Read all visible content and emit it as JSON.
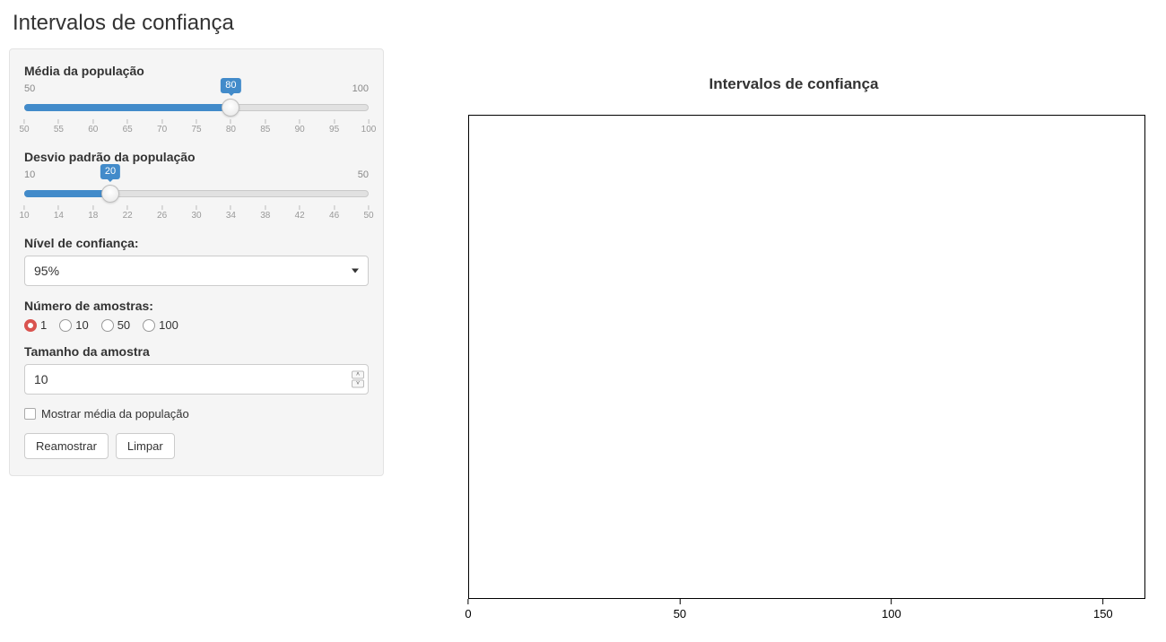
{
  "page_title": "Intervalos de confiança",
  "sidebar": {
    "mean": {
      "label": "Média da população",
      "min": 50,
      "max": 100,
      "value": 80,
      "min_text": "50",
      "max_text": "100",
      "value_text": "80",
      "ticks": [
        "50",
        "55",
        "60",
        "65",
        "70",
        "75",
        "80",
        "85",
        "90",
        "95",
        "100"
      ]
    },
    "sd": {
      "label": "Desvio padrão da população",
      "min": 10,
      "max": 50,
      "value": 20,
      "min_text": "10",
      "max_text": "50",
      "value_text": "20",
      "ticks": [
        "10",
        "14",
        "18",
        "22",
        "26",
        "30",
        "34",
        "38",
        "42",
        "46",
        "50"
      ]
    },
    "conf": {
      "label": "Nível de confiança:",
      "selected": "95%"
    },
    "nsamples": {
      "label": "Número de amostras:",
      "options": [
        "1",
        "10",
        "50",
        "100"
      ],
      "selected": "1"
    },
    "sampsize": {
      "label": "Tamanho da amostra",
      "value": "10"
    },
    "showmean": {
      "label": "Mostrar média da população",
      "checked": false
    },
    "buttons": {
      "resample": "Reamostrar",
      "clear": "Limpar"
    }
  },
  "chart_data": {
    "type": "scatter",
    "title": "Intervalos de confiança",
    "xlabel": "",
    "ylabel": "",
    "xlim": [
      0,
      160
    ],
    "x_ticks": [
      0,
      50,
      100,
      150
    ],
    "series": []
  }
}
